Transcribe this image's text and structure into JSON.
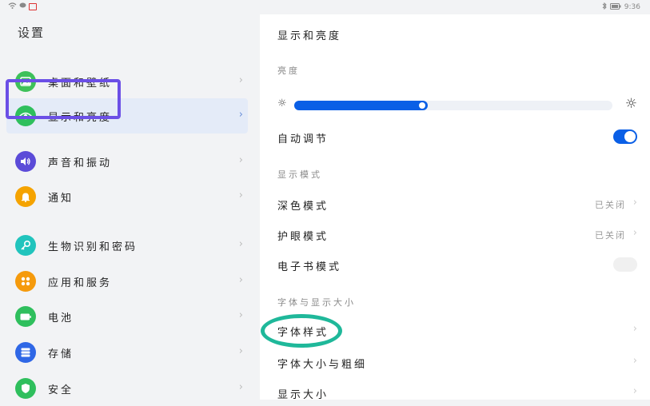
{
  "status_bar": {
    "time": "9:36"
  },
  "sidebar": {
    "title": "设置",
    "items": [
      {
        "label": "桌面和壁纸",
        "icon": "wallpaper-icon",
        "color": "#3ec15a"
      },
      {
        "label": "显示和亮度",
        "icon": "eye-icon",
        "color": "#2fbf5d",
        "selected": true
      },
      {
        "label": "声音和振动",
        "icon": "speaker-icon",
        "color": "#5b4bd8"
      },
      {
        "label": "通知",
        "icon": "bell-icon",
        "color": "#f5a300"
      },
      {
        "label": "生物识别和密码",
        "icon": "key-icon",
        "color": "#21c4bd"
      },
      {
        "label": "应用和服务",
        "icon": "apps-icon",
        "color": "#f59a0c"
      },
      {
        "label": "电池",
        "icon": "battery-icon",
        "color": "#2fbf5d"
      },
      {
        "label": "存储",
        "icon": "storage-icon",
        "color": "#2f67e6"
      },
      {
        "label": "安全",
        "icon": "shield-icon",
        "color": "#2fbf5d"
      }
    ]
  },
  "main": {
    "title": "显示和亮度",
    "brightness_section": "亮度",
    "brightness_level": 0.42,
    "auto_adjust": {
      "label": "自动调节",
      "on": true
    },
    "display_mode_section": "显示模式",
    "dark_mode": {
      "label": "深色模式",
      "value": "已关闭"
    },
    "eye_comfort": {
      "label": "护眼模式",
      "value": "已关闭"
    },
    "ebook_mode": {
      "label": "电子书模式"
    },
    "font_section": "字体与显示大小",
    "font_style": {
      "label": "字体样式"
    },
    "font_size": {
      "label": "字体大小与粗细"
    },
    "display_size": {
      "label": "显示大小"
    }
  },
  "colors": {
    "accent": "#0a5fe6",
    "highlight_outline": "#6b4fe6",
    "annotation": "#1fb89a"
  }
}
